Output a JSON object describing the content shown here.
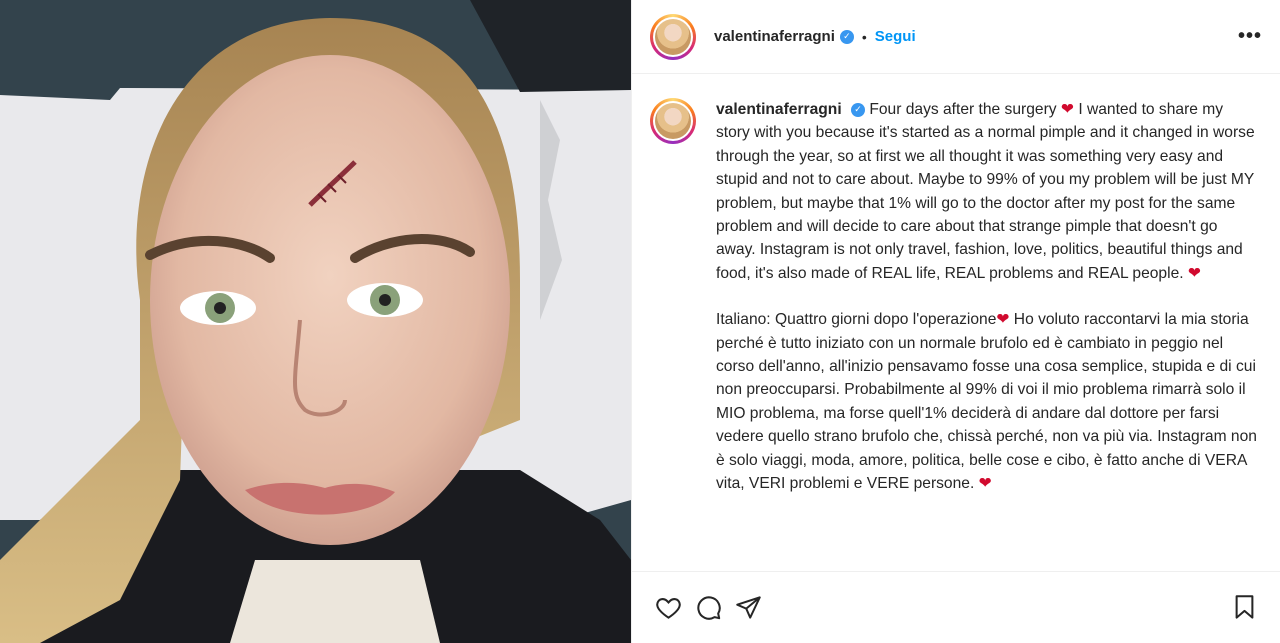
{
  "post": {
    "image_alt": "Selfie of woman with stitched scar on forehead",
    "username": "valentinaferragni",
    "verified_icon": "verified-badge-icon",
    "separator": "•",
    "follow_label": "Segui",
    "more_label": "•••",
    "caption": {
      "username": "valentinaferragni",
      "en_text_1": "Four days after the surgery",
      "heart": "❤",
      "en_text_2": " I wanted to share my story with you because it's started as a normal pimple and it changed in worse through the year, so at first we all thought it was something very easy and stupid and not to care about. Maybe to 99% of you my problem will be just MY problem, but maybe that 1% will go to the doctor after my post for the same problem and will decide to care about that strange pimple that doesn't go away. Instagram is not only travel, fashion, love, politics, beautiful things and food, it's also made of REAL life, REAL problems and REAL people.",
      "it_text_1": "Italiano: Quattro giorni dopo l'operazione",
      "it_text_2": " Ho voluto raccontarvi la mia storia perché è tutto iniziato con un normale brufolo ed è cambiato in peggio nel corso dell'anno, all'inizio pensavamo fosse una cosa semplice, stupida e di cui non preoccuparsi. Probabilmente al 99% di voi il mio problema rimarrà solo il MIO problema, ma forse quell'1% deciderà di andare dal dottore per farsi vedere quello strano brufolo che, chissà perché, non va più via. Instagram non è solo viaggi, moda, amore, politica, belle cose e cibo, è fatto anche di VERA vita, VERI problemi e VERE persone."
    },
    "actions": {
      "like_icon": "heart-outline-icon",
      "comment_icon": "comment-bubble-icon",
      "share_icon": "paper-plane-icon",
      "save_icon": "bookmark-icon"
    },
    "colors": {
      "link": "#0095f6",
      "text": "#262626",
      "border": "#efefef",
      "heart": "#d10a2e"
    }
  }
}
